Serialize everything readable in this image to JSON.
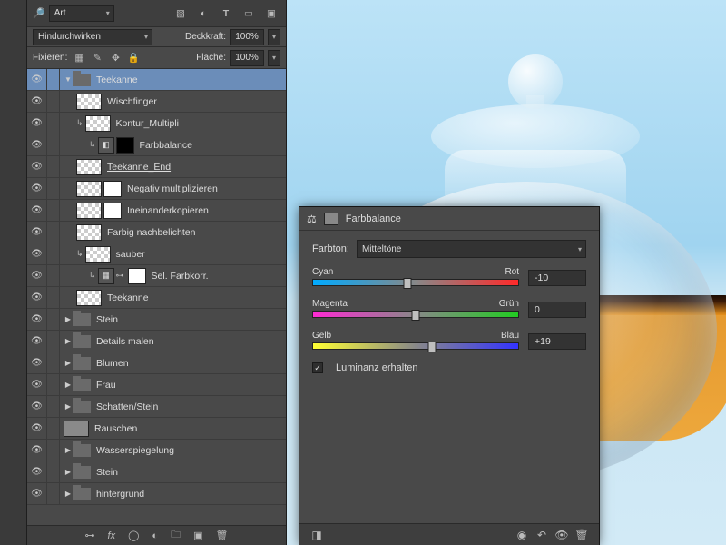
{
  "layers_panel": {
    "kind": "Art",
    "blend_mode": "Hindurchwirken",
    "opacity_label": "Deckkraft:",
    "opacity_value": "100%",
    "lock_label": "Fixieren:",
    "fill_label": "Fläche:",
    "fill_value": "100%",
    "layers": [
      {
        "name": "Teekanne",
        "type": "group",
        "selected": true,
        "open": true,
        "indent": 0
      },
      {
        "name": "Wischfinger",
        "type": "raster",
        "indent": 1,
        "checker": true
      },
      {
        "name": "Kontur_Multipli",
        "type": "raster",
        "indent": 1,
        "checker": true,
        "clip": true
      },
      {
        "name": "Farbbalance",
        "type": "adjust",
        "indent": 2,
        "clip": true,
        "mask": "black",
        "adjglyph": "◧"
      },
      {
        "name": "Teekanne_End",
        "type": "raster",
        "indent": 1,
        "checker": true,
        "underline": true,
        "trailing": true
      },
      {
        "name": "Negativ multiplizieren",
        "type": "raster",
        "indent": 1,
        "checker": true,
        "mask": "white"
      },
      {
        "name": "Ineinanderkopieren",
        "type": "raster",
        "indent": 1,
        "checker": true,
        "mask": "white"
      },
      {
        "name": "Farbig nachbelichten",
        "type": "raster",
        "indent": 1,
        "checker": true
      },
      {
        "name": "sauber",
        "type": "raster",
        "indent": 1,
        "checker": true,
        "clip": true
      },
      {
        "name": "Sel. Farbkorr.",
        "type": "adjust",
        "indent": 2,
        "clip": true,
        "mask": "white",
        "adjglyph": "▦",
        "chain": true
      },
      {
        "name": "Teekanne",
        "type": "raster",
        "indent": 1,
        "checker": true,
        "underline": true,
        "trailing": true
      },
      {
        "name": "Stein",
        "type": "group",
        "indent": 0
      },
      {
        "name": "Details malen",
        "type": "group",
        "indent": 0
      },
      {
        "name": "Blumen",
        "type": "group",
        "indent": 0
      },
      {
        "name": "Frau",
        "type": "group",
        "indent": 0
      },
      {
        "name": "Schatten/Stein",
        "type": "group",
        "indent": 0
      },
      {
        "name": "Rauschen",
        "type": "raster",
        "indent": 0,
        "grey": true
      },
      {
        "name": "Wasserspiegelung",
        "type": "group",
        "indent": 0
      },
      {
        "name": "Stein",
        "type": "group",
        "indent": 0
      },
      {
        "name": "hintergrund",
        "type": "group",
        "indent": 0
      }
    ]
  },
  "color_balance": {
    "title": "Farbbalance",
    "tone_label": "Farbton:",
    "tone_value": "Mitteltöne",
    "sliders": [
      {
        "left": "Cyan",
        "right": "Rot",
        "value": "-10",
        "pos": 46
      },
      {
        "left": "Magenta",
        "right": "Grün",
        "value": "0",
        "pos": 50
      },
      {
        "left": "Gelb",
        "right": "Blau",
        "value": "+19",
        "pos": 58
      }
    ],
    "preserve_luma": "Luminanz erhalten"
  }
}
